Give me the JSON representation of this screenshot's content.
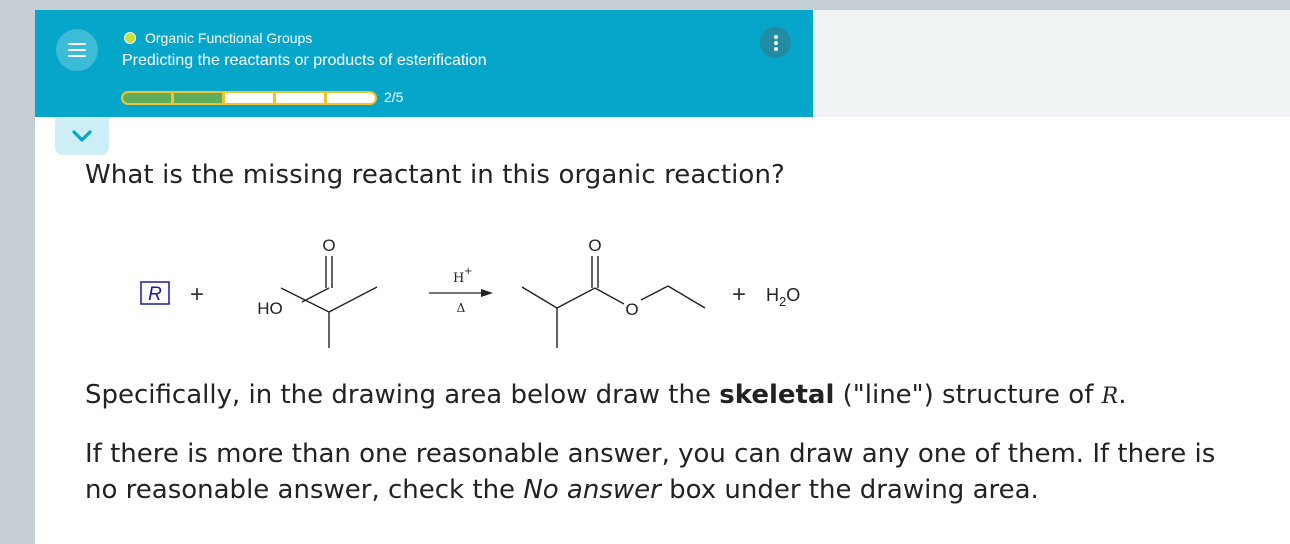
{
  "header": {
    "topic": "Organic Functional Groups",
    "title": "Predicting the reactants or products of esterification",
    "progress": {
      "current": 2,
      "total": 5,
      "label": "2/5",
      "segments_complete": 2
    }
  },
  "colors": {
    "header_bg": "#05a6c9",
    "progress_border": "#f4c22f",
    "progress_done": "#5fae5c",
    "topic_dot": "#c6df3e",
    "unknown_box": "#1a1aa6"
  },
  "icons": {
    "menu": "hamburger-icon",
    "more": "kebab-menu-icon",
    "collapse": "chevron-down-icon"
  },
  "question": "What is the missing reactant in this organic reaction?",
  "reaction": {
    "unknown": "R",
    "plus": "+",
    "reactant_oh": "HO",
    "reactant_o": "O",
    "catalyst": "H",
    "catalyst_charge": "+",
    "heat": "Δ",
    "product_carbonyl_o": "O",
    "product_ester_o": "O",
    "water_h": "H",
    "water_sub": "2",
    "water_o": "O"
  },
  "instructions": {
    "p1_a": "Specifically, in the drawing area below draw the ",
    "p1_bold": "skeletal",
    "p1_b": " (\"line\") structure of ",
    "p1_var": "R",
    "p1_end": ".",
    "p2_a": "If there is more than one reasonable answer, you can draw any one of them. If there is no reasonable answer, check the ",
    "p2_em": "No answer",
    "p2_b": " box under the drawing area."
  }
}
